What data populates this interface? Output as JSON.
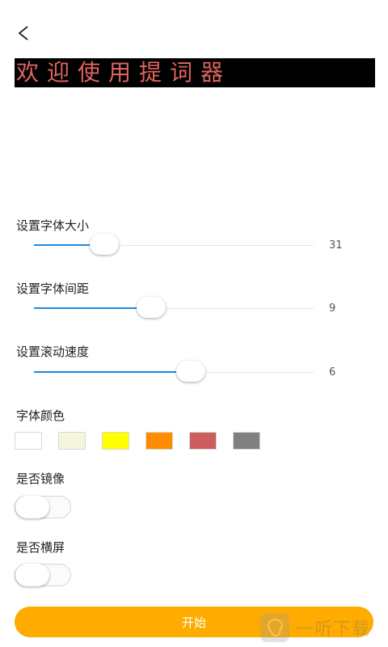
{
  "preview": {
    "text": "欢迎使用提词器"
  },
  "settings": {
    "font_size": {
      "label": "设置字体大小",
      "value": "31",
      "fraction": 0.25
    },
    "font_spacing": {
      "label": "设置字体间距",
      "value": "9",
      "fraction": 0.42
    },
    "scroll_speed": {
      "label": "设置滚动速度",
      "value": "6",
      "fraction": 0.56
    }
  },
  "font_color": {
    "label": "字体颜色",
    "swatches": [
      "#ffffff",
      "#f5f5dc",
      "#ffff00",
      "#ff8c00",
      "#cd5c5c",
      "#808080"
    ]
  },
  "mirror": {
    "label": "是否镜像",
    "on": false
  },
  "landscape": {
    "label": "是否横屏",
    "on": false
  },
  "start_button": {
    "label": "开始"
  },
  "watermark": {
    "text": "一听下载"
  },
  "colors": {
    "accent": "#1e88e5",
    "button": "#ffab00",
    "preview_text": "#e0645f"
  },
  "icons": {
    "back": "chevron-left-icon"
  }
}
